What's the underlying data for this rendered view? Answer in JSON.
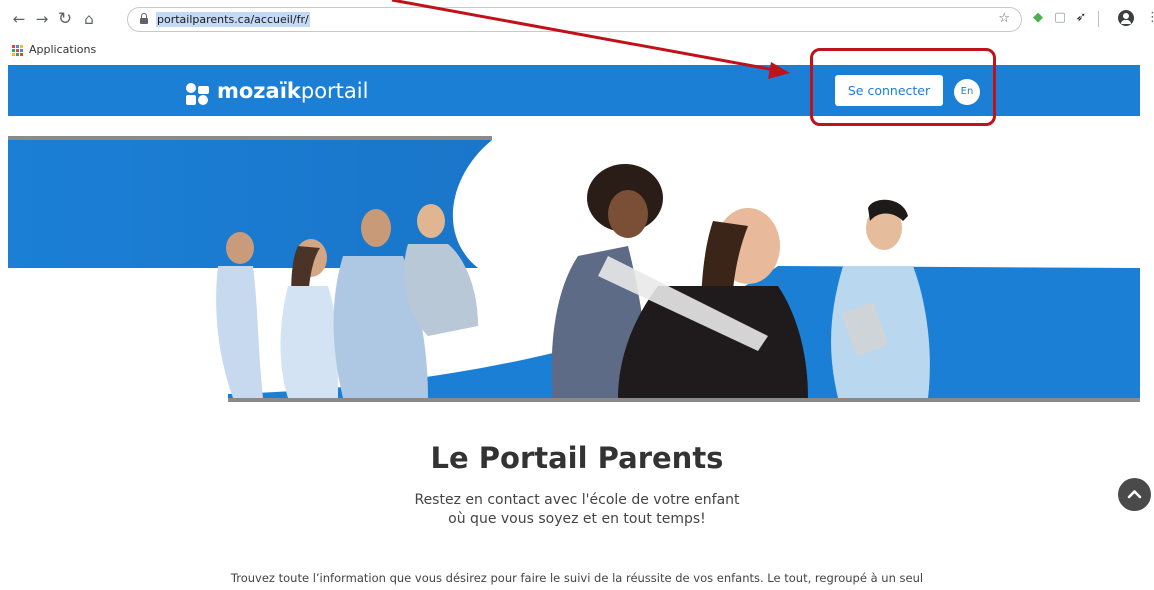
{
  "browser": {
    "url": "portailparents.ca/accueil/fr/",
    "bookmark_apps_label": "Applications"
  },
  "site": {
    "logo_bold": "mozaïk",
    "logo_light": "portail",
    "login_label": "Se connecter",
    "language_label": "En",
    "brand_color": "#1b7fd6"
  },
  "content": {
    "title": "Le Portail Parents",
    "subtitle_line1": "Restez en contact avec l'école de votre enfant",
    "subtitle_line2": "où que vous soyez et en tout temps!",
    "body": "Trouvez toute l’information que vous désirez pour faire le suivi de la réussite de vos enfants. Le tout, regroupé à un seul"
  },
  "annotation": {
    "highlight_color": "#c0121a"
  },
  "icons": {
    "back": "back-arrow-icon",
    "forward": "forward-arrow-icon",
    "reload": "reload-icon",
    "home": "home-icon",
    "lock": "lock-icon",
    "bookmark": "star-icon",
    "scroll_top": "chevron-up-icon"
  }
}
